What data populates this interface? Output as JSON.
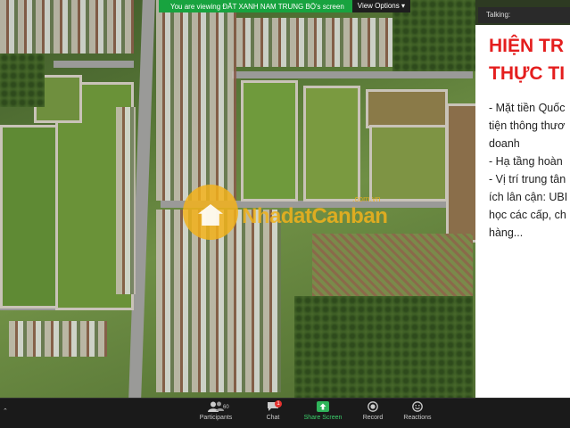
{
  "banner": {
    "viewing_text": "You are viewing ĐẤT XANH NAM TRUNG BỘ's screen",
    "view_options": "View Options ▾"
  },
  "talking_label": "Talking:",
  "slide": {
    "title_lines": [
      "HIỆN TR",
      "THỰC TI"
    ],
    "body_lines": [
      "- Mặt tiền Quốc",
      "tiện thông thươ",
      "doanh",
      "- Hạ tầng hoàn",
      "- Vị trí trung tân",
      "ích lân cận: UBI",
      "học các cấp, ch",
      "hàng..."
    ]
  },
  "watermark": {
    "brand": "NhadatCanban",
    "suffix": ".com.vn"
  },
  "toolbar": {
    "participants_label": "Participants",
    "participants_count": "60",
    "chat_label": "Chat",
    "chat_badge": "1",
    "share_label": "Share Screen",
    "record_label": "Record",
    "reactions_label": "Reactions"
  },
  "colors": {
    "banner_green": "#18a33f",
    "slide_title_red": "#e41e1e",
    "share_green": "#3cd06c",
    "toolbar_bg": "#1a1a1a"
  }
}
